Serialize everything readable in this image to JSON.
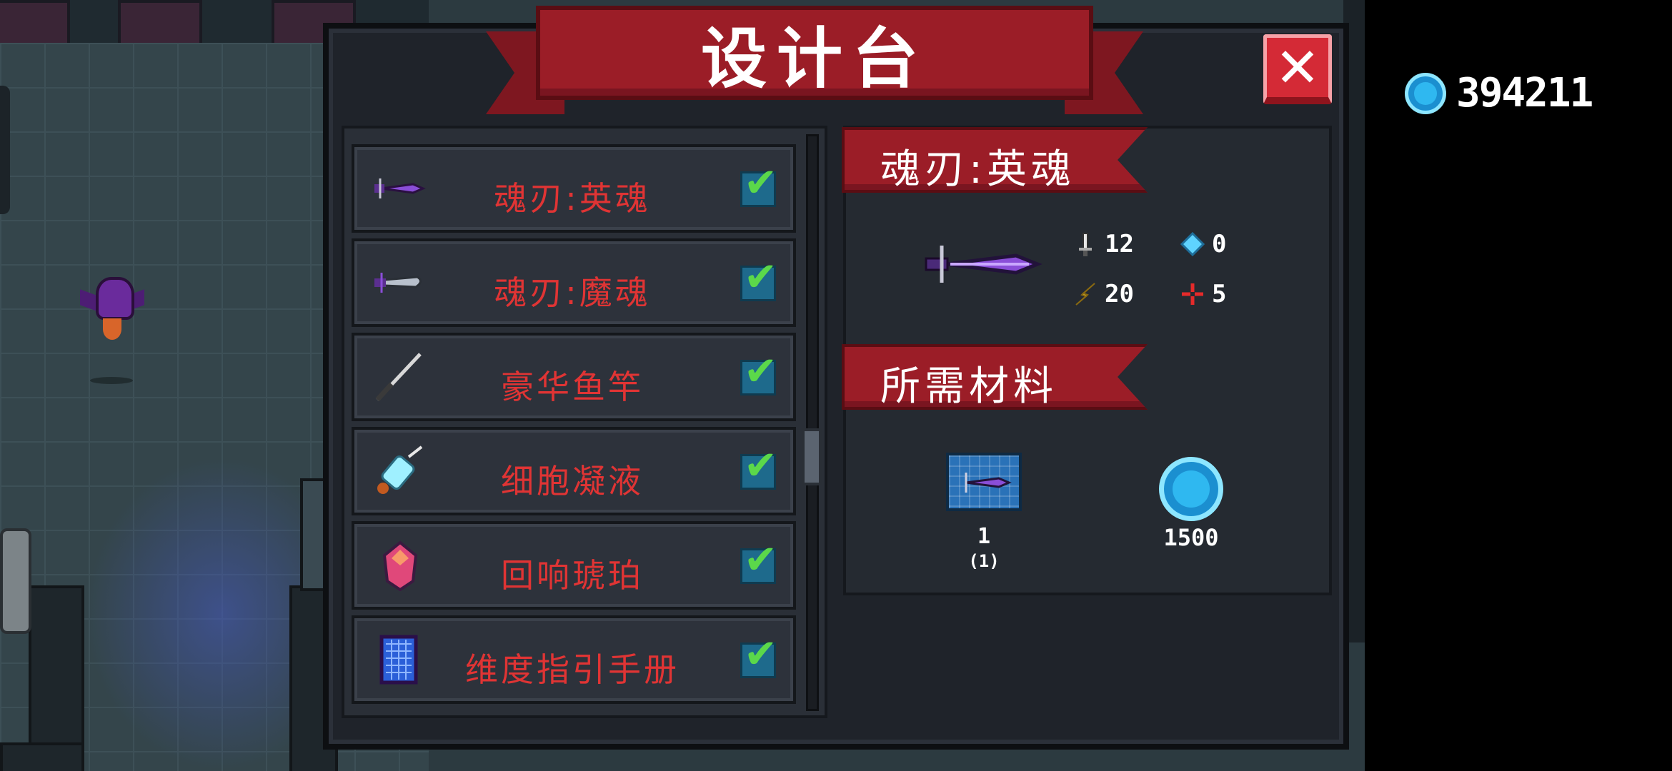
{
  "title": "设计台",
  "currency": {
    "icon": "gem-coin-icon",
    "amount": "394211"
  },
  "close_label": "✕",
  "list": {
    "items": [
      {
        "name": "魂刃:英魂",
        "icon": "purple-sword-icon",
        "checked": true
      },
      {
        "name": "魂刃:魔魂",
        "icon": "purple-blade-icon",
        "checked": true
      },
      {
        "name": "豪华鱼竿",
        "icon": "fishing-rod-icon",
        "checked": true
      },
      {
        "name": "细胞凝液",
        "icon": "syringe-icon",
        "checked": true
      },
      {
        "name": "回响琥珀",
        "icon": "amber-gem-icon",
        "checked": true
      },
      {
        "name": "维度指引手册",
        "icon": "blueprint-book-icon",
        "checked": true
      }
    ],
    "check_mark": "✔"
  },
  "detail": {
    "name": "魂刃:英魂",
    "stats": {
      "attack": "12",
      "energy": "0",
      "crit": "20",
      "accuracy": "5"
    },
    "materials_title": "所需材料",
    "materials": [
      {
        "icon": "blueprint-icon",
        "count": "1",
        "owned": "(1)"
      },
      {
        "icon": "gem-coin-icon",
        "count": "1500"
      }
    ]
  },
  "colors": {
    "banner_red": "#9b1d27",
    "item_text_red": "#e03434",
    "check_green": "#5bd84a",
    "coin_blue": "#2fb8f0"
  }
}
